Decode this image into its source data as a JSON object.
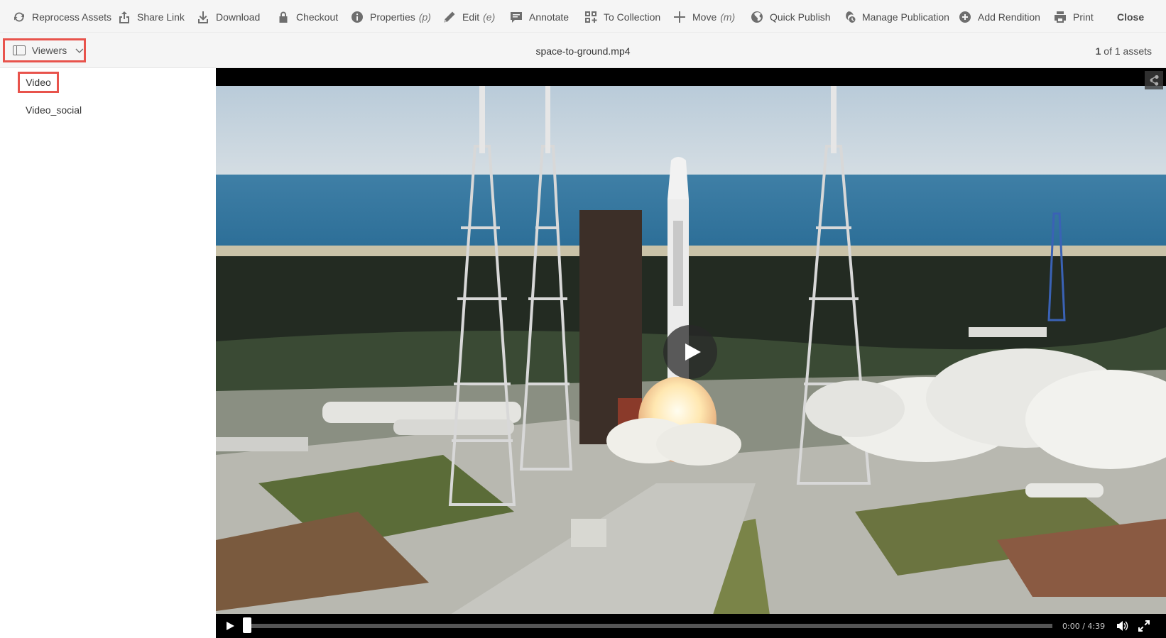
{
  "toolbar": {
    "reprocess": "Reprocess Assets",
    "share_link": "Share Link",
    "download": "Download",
    "checkout": "Checkout",
    "properties": "Properties",
    "properties_shortcut": "(p)",
    "edit": "Edit",
    "edit_shortcut": "(e)",
    "annotate": "Annotate",
    "to_collection": "To Collection",
    "move": "Move",
    "move_shortcut": "(m)",
    "quick_publish": "Quick Publish",
    "manage_publication": "Manage Publication",
    "add_rendition": "Add Rendition",
    "print": "Print",
    "close": "Close"
  },
  "subbar": {
    "viewers_label": "Viewers",
    "filename": "space-to-ground.mp4",
    "counter_current": "1",
    "counter_rest": "of 1 assets"
  },
  "rail": {
    "items": [
      {
        "label": "Video",
        "selected": true
      },
      {
        "label": "Video_social",
        "selected": false
      }
    ]
  },
  "player": {
    "time": "0:00 / 4:39",
    "progress": 0,
    "icons": [
      "share-icon",
      "play-icon",
      "volume-icon",
      "fullscreen-icon"
    ]
  },
  "colors": {
    "highlight": "#e8534c",
    "toolbar_bg": "#f5f5f5",
    "player_bg": "#000000"
  }
}
